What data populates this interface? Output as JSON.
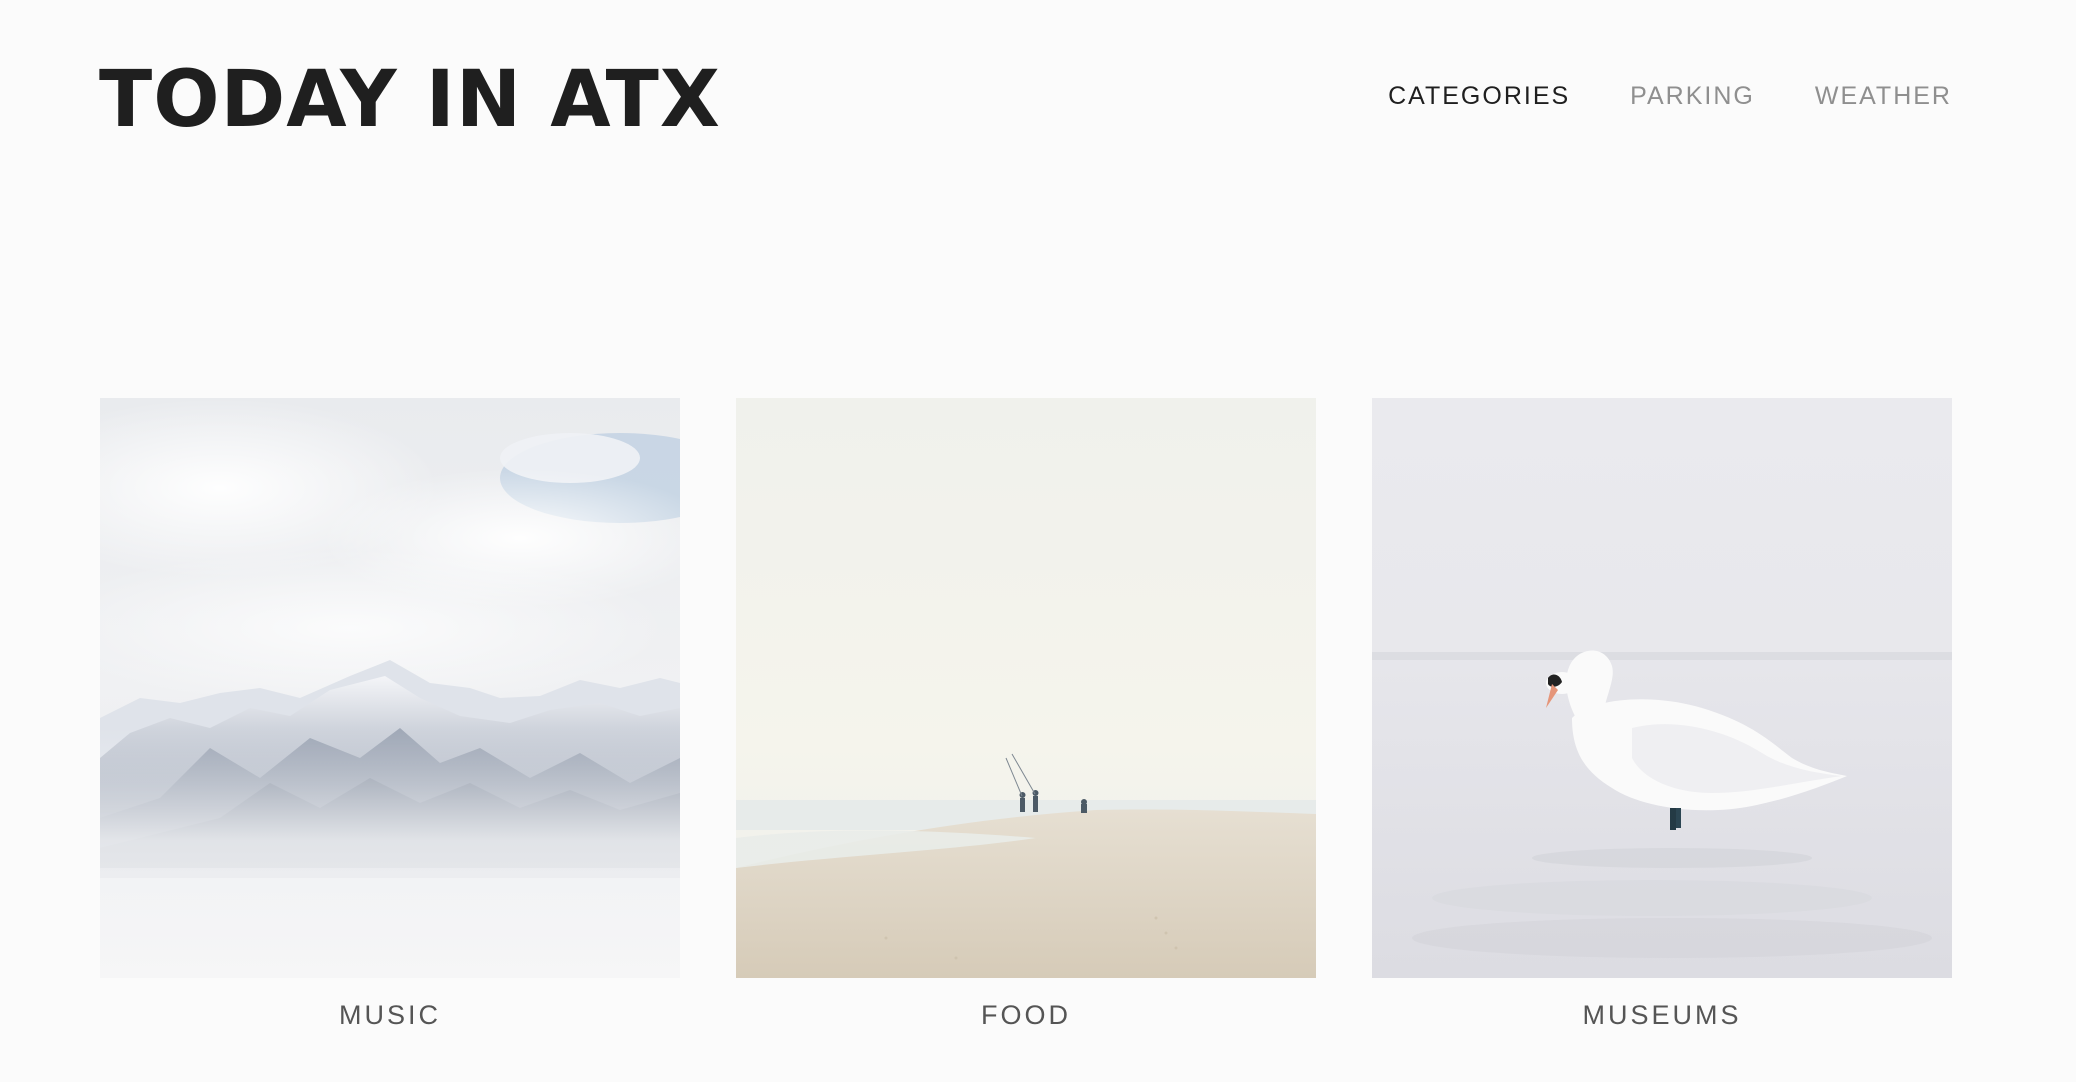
{
  "header": {
    "title": "TODAY IN ATX",
    "nav": [
      {
        "label": "CATEGORIES",
        "active": true
      },
      {
        "label": "PARKING",
        "active": false
      },
      {
        "label": "WEATHER",
        "active": false
      }
    ]
  },
  "categories": [
    {
      "label": "MUSIC",
      "image": "snowy-mountains-image"
    },
    {
      "label": "FOOD",
      "image": "beach-fishermen-image"
    },
    {
      "label": "MUSEUMS",
      "image": "swan-image"
    }
  ],
  "colors": {
    "background": "#fbfbfb",
    "title": "#1f1f1f",
    "nav_active": "#1f1f1f",
    "nav_inactive": "#8f8f8f",
    "caption": "#555555"
  }
}
